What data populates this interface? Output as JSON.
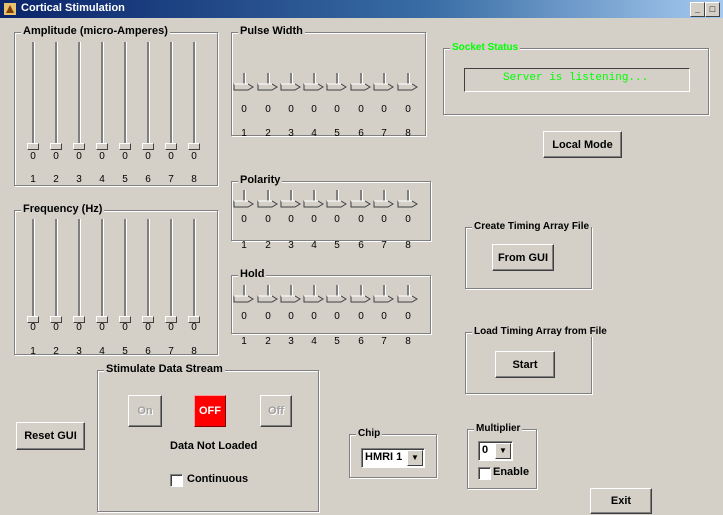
{
  "window": {
    "title": "Cortical Stimulation"
  },
  "amplitude": {
    "legend": "Amplitude (micro-Amperes)",
    "values": [
      "0",
      "0",
      "0",
      "0",
      "0",
      "0",
      "0",
      "0"
    ],
    "channels": [
      "1",
      "2",
      "3",
      "4",
      "5",
      "6",
      "7",
      "8"
    ]
  },
  "frequency": {
    "legend": "Frequency (Hz)",
    "values": [
      "0",
      "0",
      "0",
      "0",
      "0",
      "0",
      "0",
      "0"
    ],
    "channels": [
      "1",
      "2",
      "3",
      "4",
      "5",
      "6",
      "7",
      "8"
    ]
  },
  "pulse_width": {
    "legend": "Pulse Width",
    "values": [
      "0",
      "0",
      "0",
      "0",
      "0",
      "0",
      "0",
      "0"
    ],
    "channels": [
      "1",
      "2",
      "3",
      "4",
      "5",
      "6",
      "7",
      "8"
    ]
  },
  "polarity": {
    "legend": "Polarity",
    "values": [
      "0",
      "0",
      "0",
      "0",
      "0",
      "0",
      "0",
      "0"
    ],
    "channels": [
      "1",
      "2",
      "3",
      "4",
      "5",
      "6",
      "7",
      "8"
    ]
  },
  "hold": {
    "legend": "Hold",
    "values": [
      "0",
      "0",
      "0",
      "0",
      "0",
      "0",
      "0",
      "0"
    ],
    "channels": [
      "1",
      "2",
      "3",
      "4",
      "5",
      "6",
      "7",
      "8"
    ]
  },
  "socket": {
    "legend": "Socket Status",
    "message": "Server is listening...",
    "color": "#00ff00"
  },
  "local_mode": {
    "label": "Local Mode"
  },
  "create_timing": {
    "legend": "Create Timing Array File",
    "button": "From GUI"
  },
  "load_timing": {
    "legend": "Load Timing Array from File",
    "button": "Start"
  },
  "stimulate": {
    "legend": "Stimulate Data Stream",
    "on_label": "On",
    "off_red_label": "OFF",
    "off_label": "Off",
    "status": "Data Not Loaded",
    "continuous_label": "Continuous",
    "red_color": "#ff0000"
  },
  "reset": {
    "label": "Reset GUI"
  },
  "chip": {
    "legend": "Chip",
    "selected": "HMRI 1"
  },
  "multiplier": {
    "legend": "Multiplier",
    "selected": "0",
    "enable_label": "Enable"
  },
  "exit": {
    "label": "Exit"
  },
  "icons": {
    "app": "brain-app-icon",
    "pointer": "slider-pointer-icon"
  }
}
